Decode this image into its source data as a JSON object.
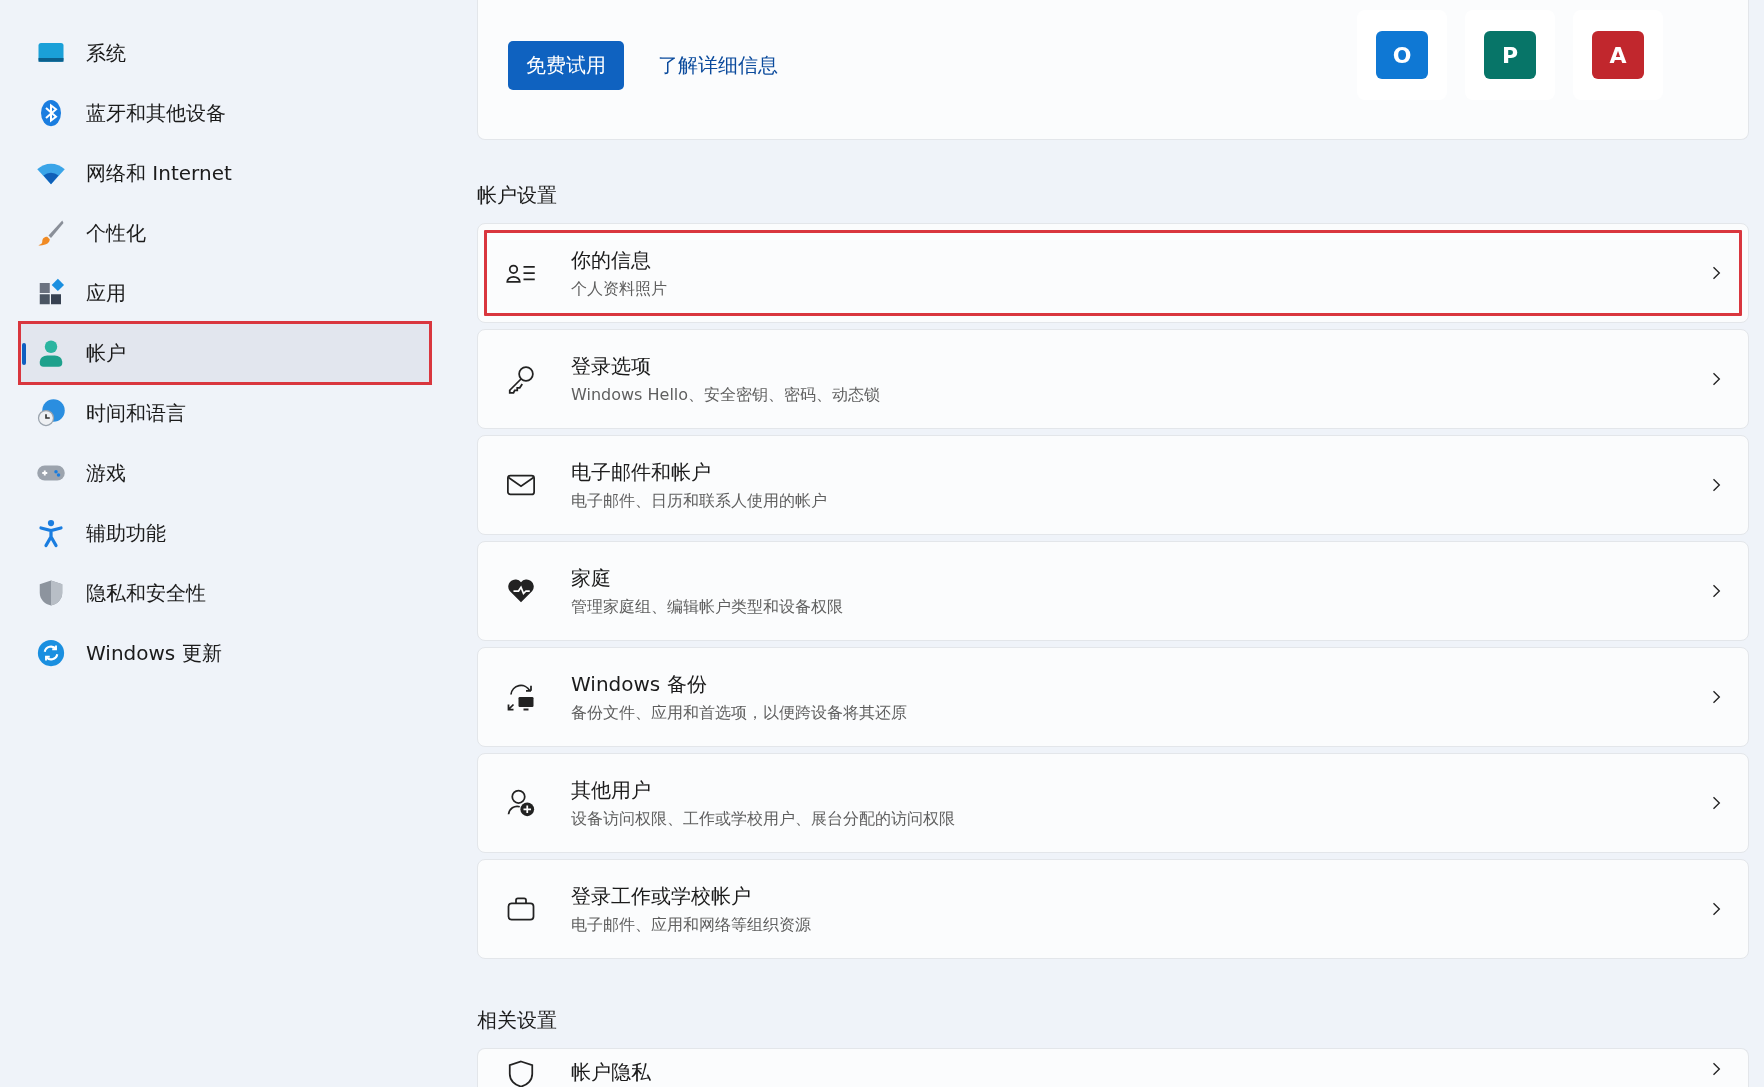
{
  "sidebar": {
    "items": [
      {
        "label": "系统",
        "selected": false,
        "highlighted": false
      },
      {
        "label": "蓝牙和其他设备",
        "selected": false,
        "highlighted": false
      },
      {
        "label": "网络和 Internet",
        "selected": false,
        "highlighted": false
      },
      {
        "label": "个性化",
        "selected": false,
        "highlighted": false
      },
      {
        "label": "应用",
        "selected": false,
        "highlighted": false
      },
      {
        "label": "帐户",
        "selected": true,
        "highlighted": true
      },
      {
        "label": "时间和语言",
        "selected": false,
        "highlighted": false
      },
      {
        "label": "游戏",
        "selected": false,
        "highlighted": false
      },
      {
        "label": "辅助功能",
        "selected": false,
        "highlighted": false
      },
      {
        "label": "隐私和安全性",
        "selected": false,
        "highlighted": false
      },
      {
        "label": "Windows 更新",
        "selected": false,
        "highlighted": false
      }
    ]
  },
  "promo": {
    "button": "免费试用",
    "link": "了解详细信息",
    "apps": [
      {
        "letter": "O",
        "color": "#0f78d4"
      },
      {
        "letter": "P",
        "color": "#077568"
      },
      {
        "letter": "A",
        "color": "#c1272d"
      }
    ]
  },
  "account_settings": {
    "heading": "帐户设置",
    "rows": [
      {
        "title": "你的信息",
        "subtitle": "个人资料照片",
        "highlighted": true
      },
      {
        "title": "登录选项",
        "subtitle": "Windows Hello、安全密钥、密码、动态锁",
        "highlighted": false
      },
      {
        "title": "电子邮件和帐户",
        "subtitle": "电子邮件、日历和联系人使用的帐户",
        "highlighted": false
      },
      {
        "title": "家庭",
        "subtitle": "管理家庭组、编辑帐户类型和设备权限",
        "highlighted": false
      },
      {
        "title": "Windows 备份",
        "subtitle": "备份文件、应用和首选项，以便跨设备将其还原",
        "highlighted": false
      },
      {
        "title": "其他用户",
        "subtitle": "设备访问权限、工作或学校用户、展台分配的访问权限",
        "highlighted": false
      },
      {
        "title": "登录工作或学校帐户",
        "subtitle": "电子邮件、应用和网络等组织资源",
        "highlighted": false
      }
    ]
  },
  "related_settings": {
    "heading": "相关设置",
    "rows": [
      {
        "title": "帐户隐私"
      }
    ]
  }
}
